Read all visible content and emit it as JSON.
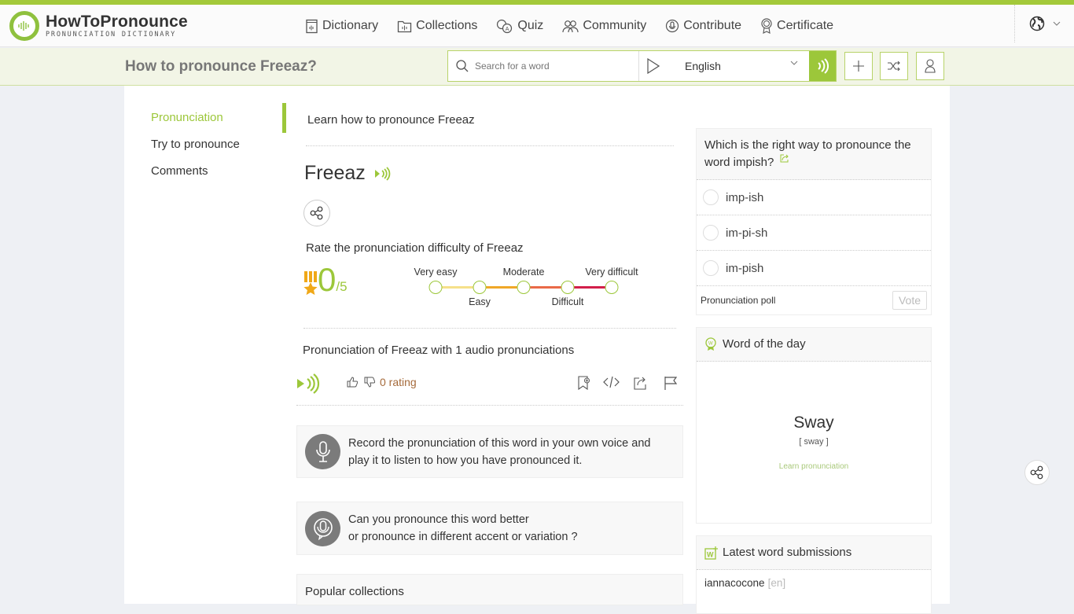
{
  "brand": {
    "title": "HowToPronounce",
    "subtitle": "Pronunciation Dictionary",
    "accent": "#9cc73a"
  },
  "nav": {
    "items": [
      {
        "label": "Dictionary",
        "icon": "dictionary-icon"
      },
      {
        "label": "Collections",
        "icon": "collections-icon"
      },
      {
        "label": "Quiz",
        "icon": "quiz-icon"
      },
      {
        "label": "Community",
        "icon": "community-icon"
      },
      {
        "label": "Contribute",
        "icon": "contribute-icon"
      },
      {
        "label": "Certificate",
        "icon": "certificate-icon"
      }
    ],
    "language_icon": "globe-icon"
  },
  "subbar": {
    "page_title": "How to pronounce Freeaz?",
    "search_placeholder": "Search for a word",
    "language": "English"
  },
  "sidebar": {
    "items": [
      {
        "label": "Pronunciation",
        "active": true
      },
      {
        "label": "Try to pronounce",
        "active": false
      },
      {
        "label": "Comments",
        "active": false
      }
    ]
  },
  "main": {
    "learn_heading": "Learn how to pronounce Freeaz",
    "word": "Freeaz",
    "rate_title": "Rate the pronunciation difficulty of Freeaz",
    "score": "0",
    "score_max": "/5",
    "difficulty_levels": [
      "Very easy",
      "Easy",
      "Moderate",
      "Difficult",
      "Very difficult"
    ],
    "pronunciation_title": "Pronunciation of Freeaz with 1 audio pronunciations",
    "rating_text": "0 rating",
    "record_text_1": "Record the pronunciation of this word in your own voice and",
    "record_text_2": "play it to listen to how you have pronounced it.",
    "better_text_1": "Can you pronounce this word better",
    "better_text_2": "or pronounce in different accent or variation ?",
    "popular_collections": "Popular collections"
  },
  "poll": {
    "question": "Which is the right way to pronounce the word impish?",
    "options": [
      "imp-ish",
      "im-pi-sh",
      "im-pish"
    ],
    "footer_label": "Pronunciation poll",
    "vote_label": "Vote"
  },
  "word_of_day": {
    "heading": "Word of the day",
    "word": "Sway",
    "phonetic": "[ sway ]",
    "link": "Learn pronunciation"
  },
  "submissions": {
    "heading": "Latest word submissions",
    "items": [
      {
        "word": "iannacocone",
        "lang": "[en]"
      }
    ]
  }
}
